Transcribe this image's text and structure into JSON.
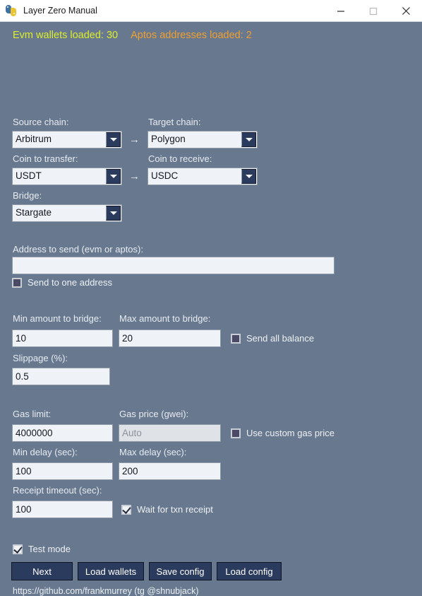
{
  "window": {
    "title": "Layer Zero Manual",
    "icon": "python-logo-icon",
    "minimize_label": "—",
    "maximize_label": "□",
    "close_label": "✕"
  },
  "status": {
    "evm_wallets": "Evm wallets loaded: 30",
    "aptos_addresses": "Aptos addresses loaded: 2",
    "evm_color": "#ddef2b",
    "aptos_color": "#f0a030"
  },
  "theme": {
    "background": "#67788f",
    "input_background": "#eff2f7",
    "input_disabled_background": "#dfe2e7",
    "button_background": "#2b3b5d",
    "label_color": "#e8ecf2",
    "titlebar_background": "#ffffff"
  },
  "form": {
    "source_chain": {
      "label": "Source chain:",
      "value": "Arbitrum"
    },
    "target_chain": {
      "label": "Target chain:",
      "value": "Polygon"
    },
    "coin_to_transfer": {
      "label": "Coin to transfer:",
      "value": "USDT"
    },
    "coin_to_receive": {
      "label": "Coin to receive:",
      "value": "USDC"
    },
    "bridge": {
      "label": "Bridge:",
      "value": "Stargate"
    },
    "arrow_glyph": "→",
    "address_to_send": {
      "label": "Address to send (evm or aptos):",
      "value": "",
      "placeholder": ""
    },
    "send_to_one_address": {
      "label": "Send to one address",
      "checked": false
    },
    "min_amount": {
      "label": "Min amount to bridge:",
      "value": "10"
    },
    "max_amount": {
      "label": "Max amount to bridge:",
      "value": "20"
    },
    "send_all_balance": {
      "label": "Send all balance",
      "checked": false
    },
    "slippage": {
      "label": "Slippage (%):",
      "value": "0.5"
    },
    "gas_limit": {
      "label": "Gas limit:",
      "value": "4000000"
    },
    "gas_price": {
      "label": "Gas price (gwei):",
      "value": "",
      "placeholder": "Auto",
      "disabled": true
    },
    "use_custom_gas_price": {
      "label": "Use custom gas price",
      "checked": false
    },
    "min_delay": {
      "label": "Min delay (sec):",
      "value": "100"
    },
    "max_delay": {
      "label": "Max delay (sec):",
      "value": "200"
    },
    "receipt_timeout": {
      "label": "Receipt timeout (sec):",
      "value": "100"
    },
    "wait_for_receipt": {
      "label": "Wait for txn receipt",
      "checked": true
    },
    "test_mode": {
      "label": "Test mode",
      "checked": true
    }
  },
  "buttons": {
    "next": "Next",
    "load_wallets": "Load wallets",
    "save_config": "Save config",
    "load_config": "Load config"
  },
  "footer": {
    "link": "https://github.com/frankmurrey (tg @shnubjack)"
  }
}
